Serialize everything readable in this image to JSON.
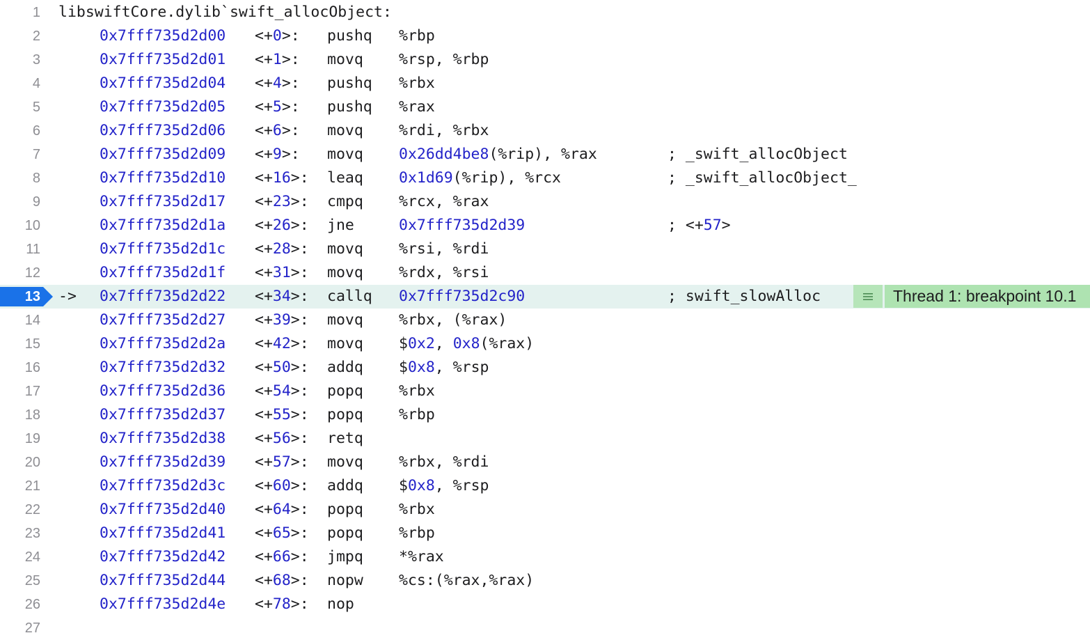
{
  "header": {
    "line_number": "1",
    "symbol": "libswiftCore.dylib`swift_allocObject:"
  },
  "instructions": [
    {
      "line": "2",
      "addr": "0x7fff735d2d00",
      "offset": "+0",
      "mnemonic": "pushq",
      "operands": "%rbp",
      "comment": ""
    },
    {
      "line": "3",
      "addr": "0x7fff735d2d01",
      "offset": "+1",
      "mnemonic": "movq",
      "operands": "%rsp, %rbp",
      "comment": ""
    },
    {
      "line": "4",
      "addr": "0x7fff735d2d04",
      "offset": "+4",
      "mnemonic": "pushq",
      "operands": "%rbx",
      "comment": ""
    },
    {
      "line": "5",
      "addr": "0x7fff735d2d05",
      "offset": "+5",
      "mnemonic": "pushq",
      "operands": "%rax",
      "comment": ""
    },
    {
      "line": "6",
      "addr": "0x7fff735d2d06",
      "offset": "+6",
      "mnemonic": "movq",
      "operands": "%rdi, %rbx",
      "comment": ""
    },
    {
      "line": "7",
      "addr": "0x7fff735d2d09",
      "offset": "+9",
      "mnemonic": "movq",
      "operands": "0x26dd4be8(%rip), %rax",
      "comment": "; _swift_allocObject"
    },
    {
      "line": "8",
      "addr": "0x7fff735d2d10",
      "offset": "+16",
      "mnemonic": "leaq",
      "operands": "0x1d69(%rip), %rcx",
      "comment": "; _swift_allocObject_"
    },
    {
      "line": "9",
      "addr": "0x7fff735d2d17",
      "offset": "+23",
      "mnemonic": "cmpq",
      "operands": "%rcx, %rax",
      "comment": ""
    },
    {
      "line": "10",
      "addr": "0x7fff735d2d1a",
      "offset": "+26",
      "mnemonic": "jne",
      "operands": "0x7fff735d2d39",
      "comment": "; <+57>"
    },
    {
      "line": "11",
      "addr": "0x7fff735d2d1c",
      "offset": "+28",
      "mnemonic": "movq",
      "operands": "%rsi, %rdi",
      "comment": ""
    },
    {
      "line": "12",
      "addr": "0x7fff735d2d1f",
      "offset": "+31",
      "mnemonic": "movq",
      "operands": "%rdx, %rsi",
      "comment": ""
    },
    {
      "line": "13",
      "addr": "0x7fff735d2d22",
      "offset": "+34",
      "mnemonic": "callq",
      "operands": "0x7fff735d2c90",
      "comment": "; swift_slowAlloc",
      "current": true,
      "pc_arrow": "->",
      "annotation": "Thread 1: breakpoint 10.1"
    },
    {
      "line": "14",
      "addr": "0x7fff735d2d27",
      "offset": "+39",
      "mnemonic": "movq",
      "operands": "%rbx, (%rax)",
      "comment": ""
    },
    {
      "line": "15",
      "addr": "0x7fff735d2d2a",
      "offset": "+42",
      "mnemonic": "movq",
      "operands": "$0x2, 0x8(%rax)",
      "comment": ""
    },
    {
      "line": "16",
      "addr": "0x7fff735d2d32",
      "offset": "+50",
      "mnemonic": "addq",
      "operands": "$0x8, %rsp",
      "comment": ""
    },
    {
      "line": "17",
      "addr": "0x7fff735d2d36",
      "offset": "+54",
      "mnemonic": "popq",
      "operands": "%rbx",
      "comment": ""
    },
    {
      "line": "18",
      "addr": "0x7fff735d2d37",
      "offset": "+55",
      "mnemonic": "popq",
      "operands": "%rbp",
      "comment": ""
    },
    {
      "line": "19",
      "addr": "0x7fff735d2d38",
      "offset": "+56",
      "mnemonic": "retq",
      "operands": "",
      "comment": ""
    },
    {
      "line": "20",
      "addr": "0x7fff735d2d39",
      "offset": "+57",
      "mnemonic": "movq",
      "operands": "%rbx, %rdi",
      "comment": ""
    },
    {
      "line": "21",
      "addr": "0x7fff735d2d3c",
      "offset": "+60",
      "mnemonic": "addq",
      "operands": "$0x8, %rsp",
      "comment": ""
    },
    {
      "line": "22",
      "addr": "0x7fff735d2d40",
      "offset": "+64",
      "mnemonic": "popq",
      "operands": "%rbx",
      "comment": ""
    },
    {
      "line": "23",
      "addr": "0x7fff735d2d41",
      "offset": "+65",
      "mnemonic": "popq",
      "operands": "%rbp",
      "comment": ""
    },
    {
      "line": "24",
      "addr": "0x7fff735d2d42",
      "offset": "+66",
      "mnemonic": "jmpq",
      "operands": "*%rax",
      "comment": ""
    },
    {
      "line": "25",
      "addr": "0x7fff735d2d44",
      "offset": "+68",
      "mnemonic": "nopw",
      "operands": "%cs:(%rax,%rax)",
      "comment": ""
    },
    {
      "line": "26",
      "addr": "0x7fff735d2d4e",
      "offset": "+78",
      "mnemonic": "nop",
      "operands": "",
      "comment": ""
    }
  ],
  "trailing_line": "27",
  "colors": {
    "address": "#2323c9",
    "text": "#1d1d1f",
    "line_number": "#8e8e93",
    "pc_marker": "#1a72e8",
    "current_line_bg": "#e4f2ef",
    "breakpoint_annotation_bg": "#aee3b1"
  },
  "icons": {
    "pc_marker": "program-counter-arrow-icon",
    "annotation": "lines-menu-icon"
  }
}
